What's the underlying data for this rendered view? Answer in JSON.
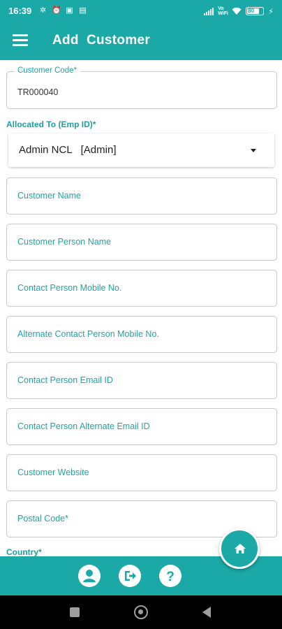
{
  "status_bar": {
    "time": "16:39",
    "volte": "Vo WiFi",
    "battery_level": "80"
  },
  "app_bar": {
    "title": "Add  Customer"
  },
  "form": {
    "customer_code": {
      "label": "Customer Code*",
      "value": "TR000040"
    },
    "allocated_to": {
      "label": "Allocated To (Emp ID)*",
      "value": "Admin NCL   [Admin]"
    },
    "fields": [
      {
        "placeholder": "Customer Name"
      },
      {
        "placeholder": "Customer Person Name"
      },
      {
        "placeholder": "Contact Person Mobile No."
      },
      {
        "placeholder": "Alternate Contact Person Mobile No."
      },
      {
        "placeholder": "Contact Person Email ID"
      },
      {
        "placeholder": "Contact Person Alternate Email ID"
      },
      {
        "placeholder": "Customer Website"
      },
      {
        "placeholder": "Postal Code*"
      }
    ],
    "country_label": "Country*"
  },
  "icons": {
    "menu": "hamburger-menu-icon",
    "home": "home-icon",
    "profile": "user-icon",
    "logout": "logout-icon",
    "help": "help-icon"
  },
  "colors": {
    "primary": "#1aa9a6",
    "label": "#23a3a0"
  }
}
